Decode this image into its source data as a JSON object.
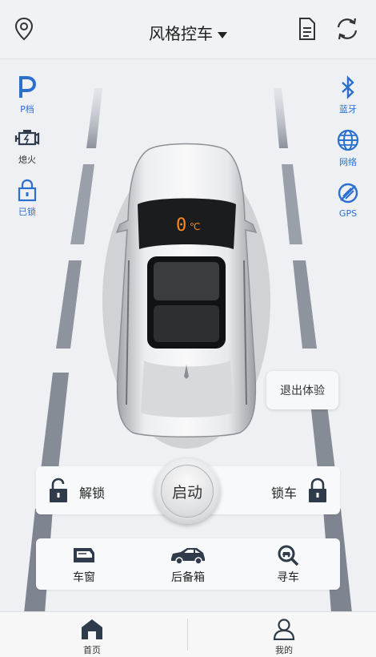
{
  "header": {
    "title": "风格控车",
    "location_icon": "location-pin-icon",
    "document_icon": "document-icon",
    "refresh_icon": "refresh-icon"
  },
  "left_status": [
    {
      "icon": "p-gear-icon",
      "label": "P档"
    },
    {
      "icon": "engine-icon",
      "label": "熄火"
    },
    {
      "icon": "lock-icon",
      "label": "已锁"
    }
  ],
  "right_status": [
    {
      "icon": "bluetooth-icon",
      "label": "蓝牙"
    },
    {
      "icon": "globe-icon",
      "label": "网络"
    },
    {
      "icon": "gps-icon",
      "label": "GPS"
    }
  ],
  "car": {
    "temperature": "0",
    "temperature_unit": "℃"
  },
  "exit_label": "退出体验",
  "control": {
    "unlock_label": "解锁",
    "start_label": "启动",
    "lock_label": "锁车"
  },
  "functions": [
    {
      "icon": "car-window-icon",
      "label": "车窗"
    },
    {
      "icon": "car-trunk-icon",
      "label": "后备箱"
    },
    {
      "icon": "find-car-icon",
      "label": "寻车"
    }
  ],
  "nav": [
    {
      "icon": "home-icon",
      "label": "首页"
    },
    {
      "icon": "user-icon",
      "label": "我的"
    }
  ],
  "colors": {
    "accent": "#2b6fcf",
    "dark_icon": "#2f3a4a",
    "temp": "#ff8a1c"
  }
}
